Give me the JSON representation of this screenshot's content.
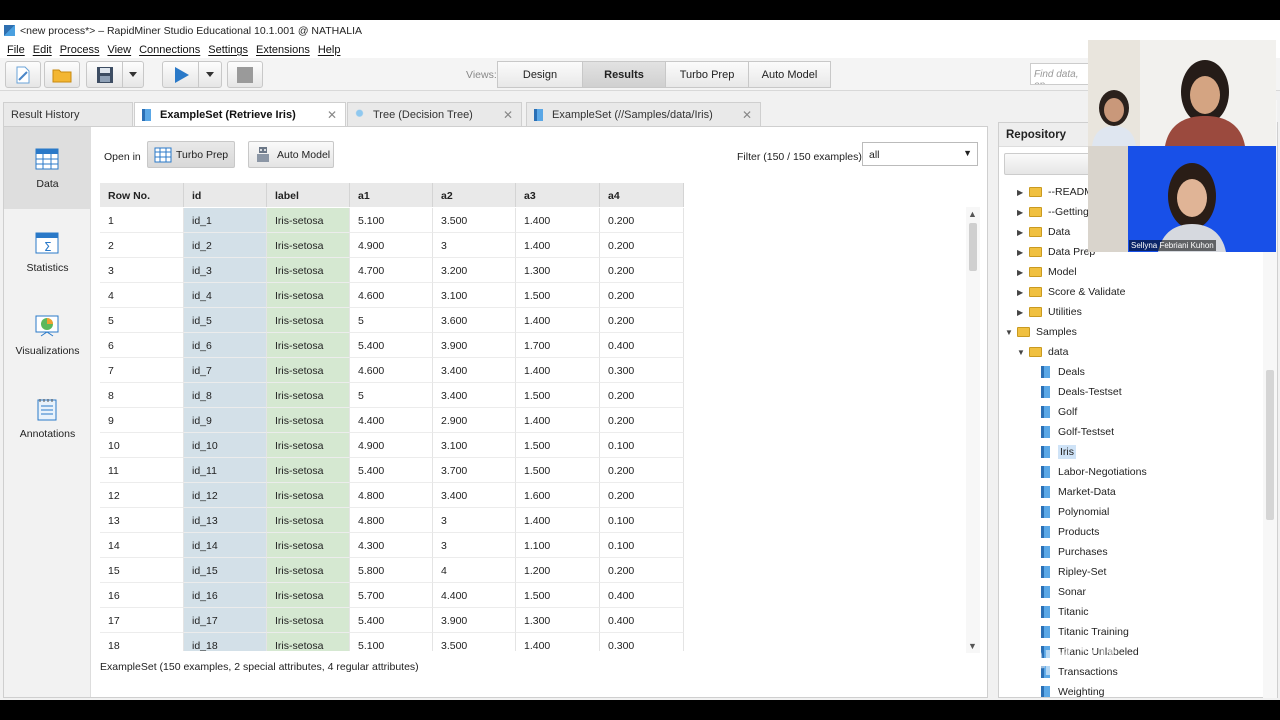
{
  "window": {
    "title": "<new process*> – RapidMiner Studio Educational 10.1.001 @ NATHALIA"
  },
  "menu": [
    "File",
    "Edit",
    "Process",
    "View",
    "Connections",
    "Settings",
    "Extensions",
    "Help"
  ],
  "toolbar": {
    "views_label": "Views:",
    "views": [
      "Design",
      "Results",
      "Turbo Prep",
      "Auto Model"
    ],
    "active_view": "Results",
    "find_placeholder": "Find data, op"
  },
  "tabs": [
    {
      "label": "Result History",
      "closable": false,
      "icon": "none"
    },
    {
      "label": "ExampleSet (Retrieve Iris)",
      "closable": true,
      "active": true,
      "icon": "dataset-icon"
    },
    {
      "label": "Tree (Decision Tree)",
      "closable": true,
      "icon": "tree-icon"
    },
    {
      "label": "ExampleSet (//Samples/data/Iris)",
      "closable": true,
      "icon": "dataset-icon"
    }
  ],
  "leftnav": [
    {
      "label": "Data",
      "icon": "data-table-icon",
      "active": true
    },
    {
      "label": "Statistics",
      "icon": "statistics-icon"
    },
    {
      "label": "Visualizations",
      "icon": "visualizations-icon"
    },
    {
      "label": "Annotations",
      "icon": "annotations-icon"
    }
  ],
  "open_in": {
    "label": "Open in",
    "turbo_prep": "Turbo Prep",
    "auto_model": "Auto Model"
  },
  "filter": {
    "label": "Filter (150 / 150 examples):",
    "value": "all"
  },
  "table": {
    "columns": [
      "Row No.",
      "id",
      "label",
      "a1",
      "a2",
      "a3",
      "a4"
    ],
    "rows": [
      [
        "1",
        "id_1",
        "Iris-setosa",
        "5.100",
        "3.500",
        "1.400",
        "0.200"
      ],
      [
        "2",
        "id_2",
        "Iris-setosa",
        "4.900",
        "3",
        "1.400",
        "0.200"
      ],
      [
        "3",
        "id_3",
        "Iris-setosa",
        "4.700",
        "3.200",
        "1.300",
        "0.200"
      ],
      [
        "4",
        "id_4",
        "Iris-setosa",
        "4.600",
        "3.100",
        "1.500",
        "0.200"
      ],
      [
        "5",
        "id_5",
        "Iris-setosa",
        "5",
        "3.600",
        "1.400",
        "0.200"
      ],
      [
        "6",
        "id_6",
        "Iris-setosa",
        "5.400",
        "3.900",
        "1.700",
        "0.400"
      ],
      [
        "7",
        "id_7",
        "Iris-setosa",
        "4.600",
        "3.400",
        "1.400",
        "0.300"
      ],
      [
        "8",
        "id_8",
        "Iris-setosa",
        "5",
        "3.400",
        "1.500",
        "0.200"
      ],
      [
        "9",
        "id_9",
        "Iris-setosa",
        "4.400",
        "2.900",
        "1.400",
        "0.200"
      ],
      [
        "10",
        "id_10",
        "Iris-setosa",
        "4.900",
        "3.100",
        "1.500",
        "0.100"
      ],
      [
        "11",
        "id_11",
        "Iris-setosa",
        "5.400",
        "3.700",
        "1.500",
        "0.200"
      ],
      [
        "12",
        "id_12",
        "Iris-setosa",
        "4.800",
        "3.400",
        "1.600",
        "0.200"
      ],
      [
        "13",
        "id_13",
        "Iris-setosa",
        "4.800",
        "3",
        "1.400",
        "0.100"
      ],
      [
        "14",
        "id_14",
        "Iris-setosa",
        "4.300",
        "3",
        "1.100",
        "0.100"
      ],
      [
        "15",
        "id_15",
        "Iris-setosa",
        "5.800",
        "4",
        "1.200",
        "0.200"
      ],
      [
        "16",
        "id_16",
        "Iris-setosa",
        "5.700",
        "4.400",
        "1.500",
        "0.400"
      ],
      [
        "17",
        "id_17",
        "Iris-setosa",
        "5.400",
        "3.900",
        "1.300",
        "0.400"
      ],
      [
        "18",
        "id_18",
        "Iris-setosa",
        "5.100",
        "3.500",
        "1.400",
        "0.300"
      ]
    ]
  },
  "footer": "ExampleSet (150 examples, 2 special attributes, 4 regular attributes)",
  "repository": {
    "title": "Repository",
    "tree": [
      {
        "label": "--READM",
        "type": "folder",
        "level": 1,
        "toggle": "▶"
      },
      {
        "label": "--Getting S",
        "type": "folder",
        "level": 1,
        "toggle": "▶"
      },
      {
        "label": "Data",
        "type": "folder",
        "level": 1,
        "toggle": "▶"
      },
      {
        "label": "Data Prep",
        "type": "folder",
        "level": 1,
        "toggle": "▶"
      },
      {
        "label": "Model",
        "type": "folder",
        "level": 1,
        "toggle": "▶"
      },
      {
        "label": "Score & Validate",
        "type": "folder",
        "level": 1,
        "toggle": "▶"
      },
      {
        "label": "Utilities",
        "type": "folder",
        "level": 1,
        "toggle": "▶"
      },
      {
        "label": "Samples",
        "type": "folder",
        "level": 0,
        "toggle": "▼"
      },
      {
        "label": "data",
        "type": "folder",
        "level": 1,
        "toggle": "▼"
      },
      {
        "label": "Deals",
        "type": "dataset",
        "level": 2
      },
      {
        "label": "Deals-Testset",
        "type": "dataset",
        "level": 2
      },
      {
        "label": "Golf",
        "type": "dataset",
        "level": 2
      },
      {
        "label": "Golf-Testset",
        "type": "dataset",
        "level": 2
      },
      {
        "label": "Iris",
        "type": "dataset",
        "level": 2,
        "selected": true
      },
      {
        "label": "Labor-Negotiations",
        "type": "dataset",
        "level": 2
      },
      {
        "label": "Market-Data",
        "type": "dataset",
        "level": 2
      },
      {
        "label": "Polynomial",
        "type": "dataset",
        "level": 2
      },
      {
        "label": "Products",
        "type": "dataset",
        "level": 2
      },
      {
        "label": "Purchases",
        "type": "dataset",
        "level": 2
      },
      {
        "label": "Ripley-Set",
        "type": "dataset",
        "level": 2
      },
      {
        "label": "Sonar",
        "type": "dataset",
        "level": 2
      },
      {
        "label": "Titanic",
        "type": "dataset",
        "level": 2
      },
      {
        "label": "Titanic Training",
        "type": "dataset",
        "level": 2
      },
      {
        "label": "Titanic Unlabeled",
        "type": "dataset",
        "level": 2
      },
      {
        "label": "Transactions",
        "type": "dataset",
        "level": 2
      },
      {
        "label": "Weighting",
        "type": "dataset",
        "level": 2
      }
    ]
  },
  "video_call": {
    "participant_name": "Sellyna Febriani Kuhon"
  },
  "watermark": "CapCut",
  "colors": {
    "id_column": "#d3e0e8",
    "label_column": "#d5e8d1",
    "play_button": "#2a79c8"
  }
}
